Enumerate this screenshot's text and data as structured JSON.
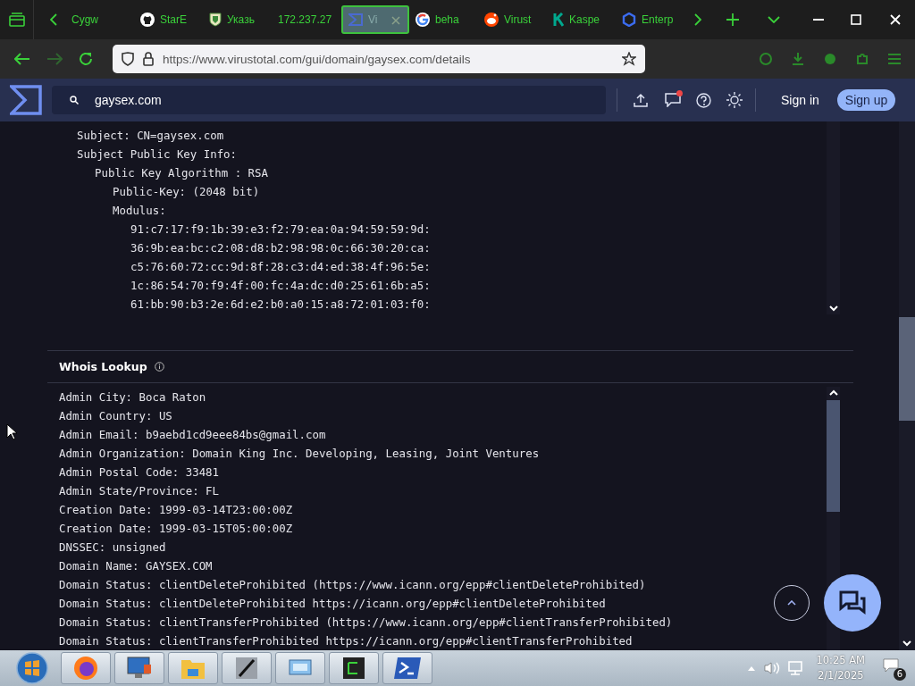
{
  "browser": {
    "tabs": [
      {
        "label": "Cygw",
        "kind": "plain",
        "selected": false
      },
      {
        "label": "StarE",
        "kind": "github",
        "selected": false
      },
      {
        "label": "Указь",
        "kind": "shield",
        "selected": false
      },
      {
        "label": "172.237.27",
        "kind": "plain",
        "selected": false
      },
      {
        "label": "Vi",
        "kind": "sigma",
        "selected": true
      },
      {
        "label": "beha",
        "kind": "google",
        "selected": false
      },
      {
        "label": "Virust",
        "kind": "reddit",
        "selected": false
      },
      {
        "label": "Kaspe",
        "kind": "kaspersky",
        "selected": false
      },
      {
        "label": "Enterp",
        "kind": "hexagon",
        "selected": false
      }
    ],
    "url": "https://www.virustotal.com/gui/domain/gaysex.com/details"
  },
  "header": {
    "search": "gaysex.com",
    "has_notification": true,
    "sign_in": "Sign in",
    "sign_up": "Sign up"
  },
  "certificate": [
    {
      "text": "Subject: CN=gaysex.com"
    },
    {
      "text": "Subject Public Key Info:",
      "children": [
        {
          "text": "Public Key Algorithm : RSA",
          "children": [
            {
              "text": "Public-Key: (2048 bit)"
            },
            {
              "text": "Modulus:",
              "children": [
                {
                  "text": "91:c7:17:f9:1b:39:e3:f2:79:ea:0a:94:59:59:9d:"
                },
                {
                  "text": "36:9b:ea:bc:c2:08:d8:b2:98:98:0c:66:30:20:ca:"
                },
                {
                  "text": "c5:76:60:72:cc:9d:8f:28:c3:d4:ed:38:4f:96:5e:"
                },
                {
                  "text": "1c:86:54:70:f9:4f:00:fc:4a:dc:d0:25:61:6b:a5:"
                },
                {
                  "text": "61:bb:90:b3:2e:6d:e2:b0:a0:15:a8:72:01:03:f0:"
                }
              ]
            }
          ]
        }
      ]
    }
  ],
  "whois": {
    "title": "Whois Lookup",
    "lines": [
      "Admin City: Boca Raton",
      "Admin Country: US",
      "Admin Email: b9aebd1cd9eee84bs@gmail.com",
      "Admin Organization: Domain King Inc. Developing, Leasing, Joint Ventures",
      "Admin Postal Code: 33481",
      "Admin State/Province: FL",
      "Creation Date: 1999-03-14T23:00:00Z",
      "Creation Date: 1999-03-15T05:00:00Z",
      "DNSSEC: unsigned",
      "Domain Name: GAYSEX.COM",
      "Domain Status: clientDeleteProhibited (https://www.icann.org/epp#clientDeleteProhibited)",
      "Domain Status: clientDeleteProhibited https://icann.org/epp#clientDeleteProhibited",
      "Domain Status: clientTransferProhibited (https://www.icann.org/epp#clientTransferProhibited)",
      "Domain Status: clientTransferProhibited https://icann.org/epp#clientTransferProhibited"
    ]
  },
  "taskbar": {
    "time": "10:25 AM",
    "date": "2/1/2025",
    "notifications": "6"
  }
}
